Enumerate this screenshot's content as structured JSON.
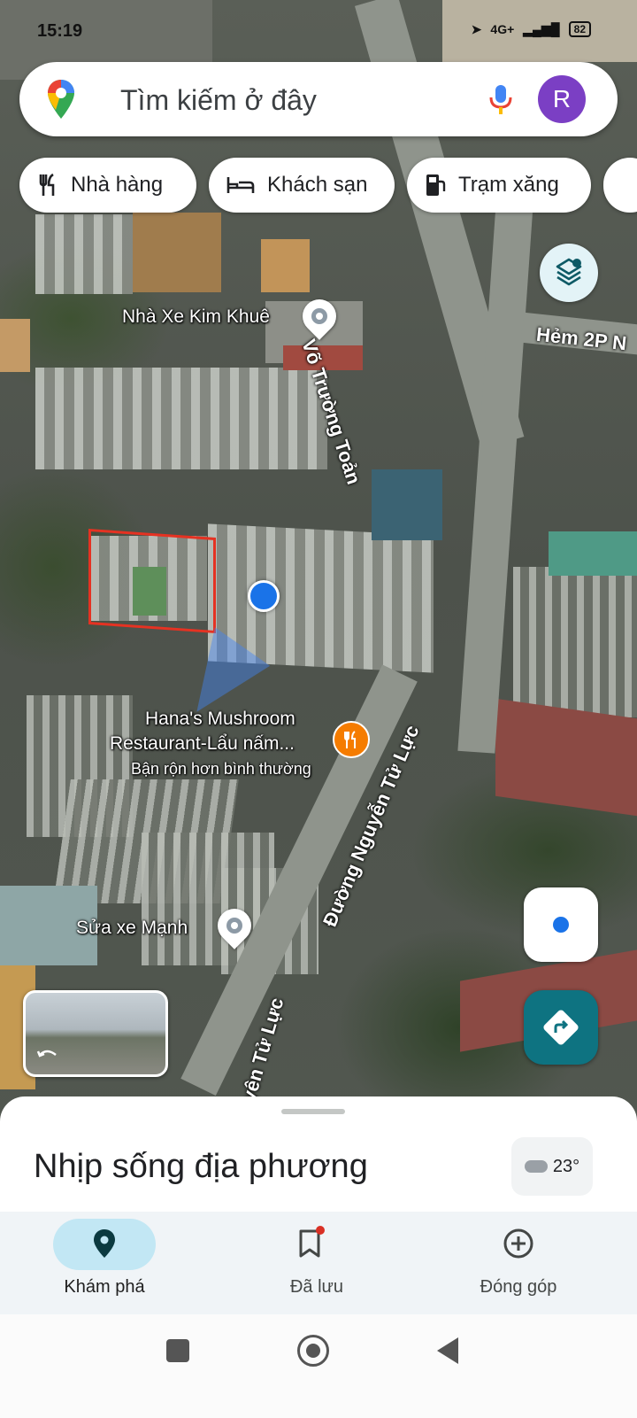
{
  "status_bar": {
    "time": "15:19",
    "network": "4G+",
    "battery": "82"
  },
  "search": {
    "placeholder": "Tìm kiếm ở đây",
    "avatar_letter": "R"
  },
  "chips": [
    {
      "label": "Nhà hàng",
      "icon": "restaurant-icon"
    },
    {
      "label": "Khách sạn",
      "icon": "hotel-icon"
    },
    {
      "label": "Trạm xăng",
      "icon": "gas-station-icon"
    }
  ],
  "map": {
    "places": [
      {
        "name": "Nhà Xe Kim Khuê"
      },
      {
        "name": "Hana's Mushroom",
        "name_line2": "Restaurant-Lẩu nấm...",
        "status": "Bận rộn hơn bình thường"
      },
      {
        "name": "Sửa xe Mạnh"
      }
    ],
    "roads": [
      "Võ Trường Toản",
      "Hẻm 2P N",
      "Đường Nguyễn Tử Lực",
      "yên Tử Lực"
    ]
  },
  "bottom_sheet": {
    "title": "Nhịp sống địa phương",
    "temperature": "23°"
  },
  "bottom_nav": [
    {
      "label": "Khám phá",
      "active": true
    },
    {
      "label": "Đã lưu",
      "active": false
    },
    {
      "label": "Đóng góp",
      "active": false
    }
  ],
  "colors": {
    "accent": "#0e7381",
    "user_dot": "#1a73e8",
    "avatar": "#7b3fc4",
    "restaurant": "#f57c00"
  }
}
